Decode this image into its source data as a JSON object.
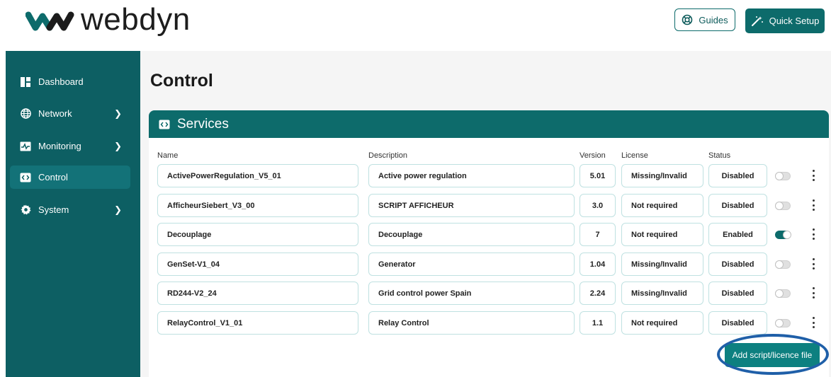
{
  "app": {
    "logo_text": "webdyn",
    "guides_label": "Guides",
    "quick_setup_label": "Quick Setup"
  },
  "sidebar": {
    "items": [
      {
        "label": "Dashboard",
        "icon": "dashboard-icon",
        "has_submenu": false,
        "active": false
      },
      {
        "label": "Network",
        "icon": "globe-icon",
        "has_submenu": true,
        "active": false
      },
      {
        "label": "Monitoring",
        "icon": "monitoring-icon",
        "has_submenu": true,
        "active": false
      },
      {
        "label": "Control",
        "icon": "code-icon",
        "has_submenu": false,
        "active": true
      },
      {
        "label": "System",
        "icon": "gear-icon",
        "has_submenu": true,
        "active": false
      }
    ]
  },
  "main": {
    "page_title": "Control",
    "card_title": "Services",
    "columns": {
      "name": "Name",
      "description": "Description",
      "version": "Version",
      "license": "License",
      "status": "Status"
    },
    "rows": [
      {
        "name": "ActivePowerRegulation_V5_01",
        "description": "Active power regulation",
        "version": "5.01",
        "license": "Missing/Invalid",
        "status": "Disabled",
        "enabled": false
      },
      {
        "name": "AfficheurSiebert_V3_00",
        "description": "SCRIPT AFFICHEUR",
        "version": "3.0",
        "license": "Not required",
        "status": "Disabled",
        "enabled": false
      },
      {
        "name": "Decouplage",
        "description": "Decouplage",
        "version": "7",
        "license": "Not required",
        "status": "Enabled",
        "enabled": true
      },
      {
        "name": "GenSet-V1_04",
        "description": "Generator",
        "version": "1.04",
        "license": "Missing/Invalid",
        "status": "Disabled",
        "enabled": false
      },
      {
        "name": "RD244-V2_24",
        "description": "Grid control power Spain",
        "version": "2.24",
        "license": "Missing/Invalid",
        "status": "Disabled",
        "enabled": false
      },
      {
        "name": "RelayControl_V1_01",
        "description": "Relay Control",
        "version": "1.1",
        "license": "Not required",
        "status": "Disabled",
        "enabled": false
      }
    ],
    "add_button_label": "Add script/licence file"
  },
  "colors": {
    "brand": "#0d6b6b",
    "sidebar": "#0d5f63",
    "highlight": "#1f5fa8"
  }
}
